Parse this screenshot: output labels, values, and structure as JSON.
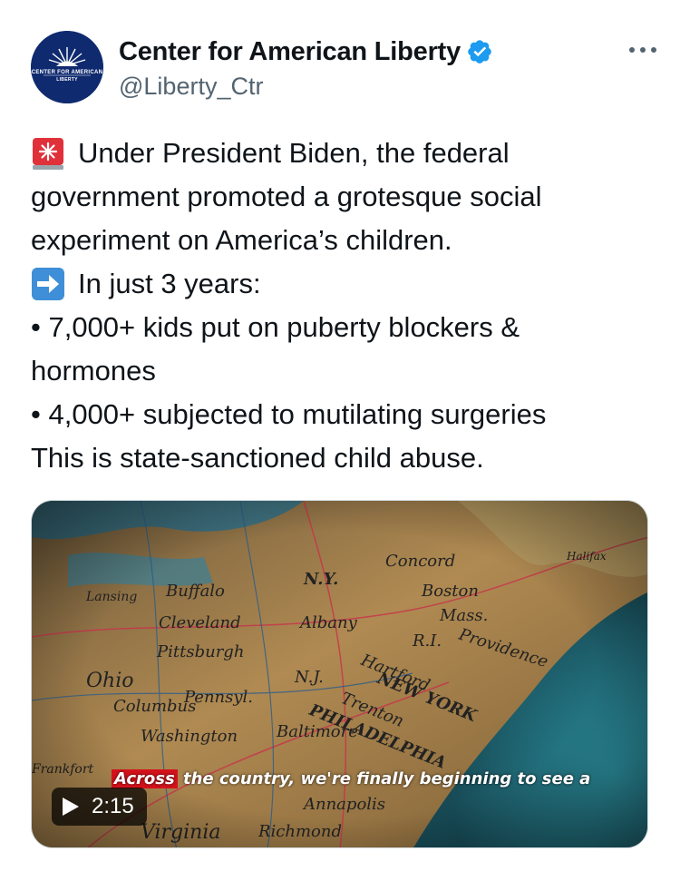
{
  "account": {
    "display_name": "Center for American Liberty",
    "handle": "@Liberty_Ctr",
    "avatar_text_top": "CENTER FOR AMERICAN",
    "avatar_text_bottom": "LIBERTY",
    "avatar_color": "#0f2a6e",
    "verified_color": "#1d9bf0"
  },
  "tweet": {
    "lines": [
      "Under President Biden, the federal",
      "government promoted a grotesque social",
      "experiment on America’s children.",
      "In just 3 years:",
      "• 7,000+ kids put on puberty blockers &",
      "hormones",
      "• 4,000+ subjected to mutilating surgeries",
      "This is state-sanctioned child abuse."
    ],
    "icons": [
      "siren-emoji",
      "right-arrow-emoji"
    ]
  },
  "video": {
    "caption_highlight": "Across",
    "caption_rest": " the country, we're finally beginning to see a",
    "duration": "2:15",
    "map_labels": [
      "Buffalo",
      "N.Y.",
      "Albany",
      "Boston",
      "Mass.",
      "Providence",
      "R.I.",
      "Cleveland",
      "Pittsburgh",
      "Ohio",
      "Pennsyl.",
      "N.J.",
      "NEW YORK",
      "Hartford",
      "Trenton",
      "PHILADELPHIA",
      "Columbus",
      "Washington",
      "Baltimore",
      "Annapolis",
      "Richmond",
      "Virginia",
      "Concord",
      "Halifax",
      "Lansing",
      "Frankfort"
    ]
  },
  "colors": {
    "text": "#0f1419",
    "secondary": "#536471",
    "caption_red": "#d4121b"
  }
}
